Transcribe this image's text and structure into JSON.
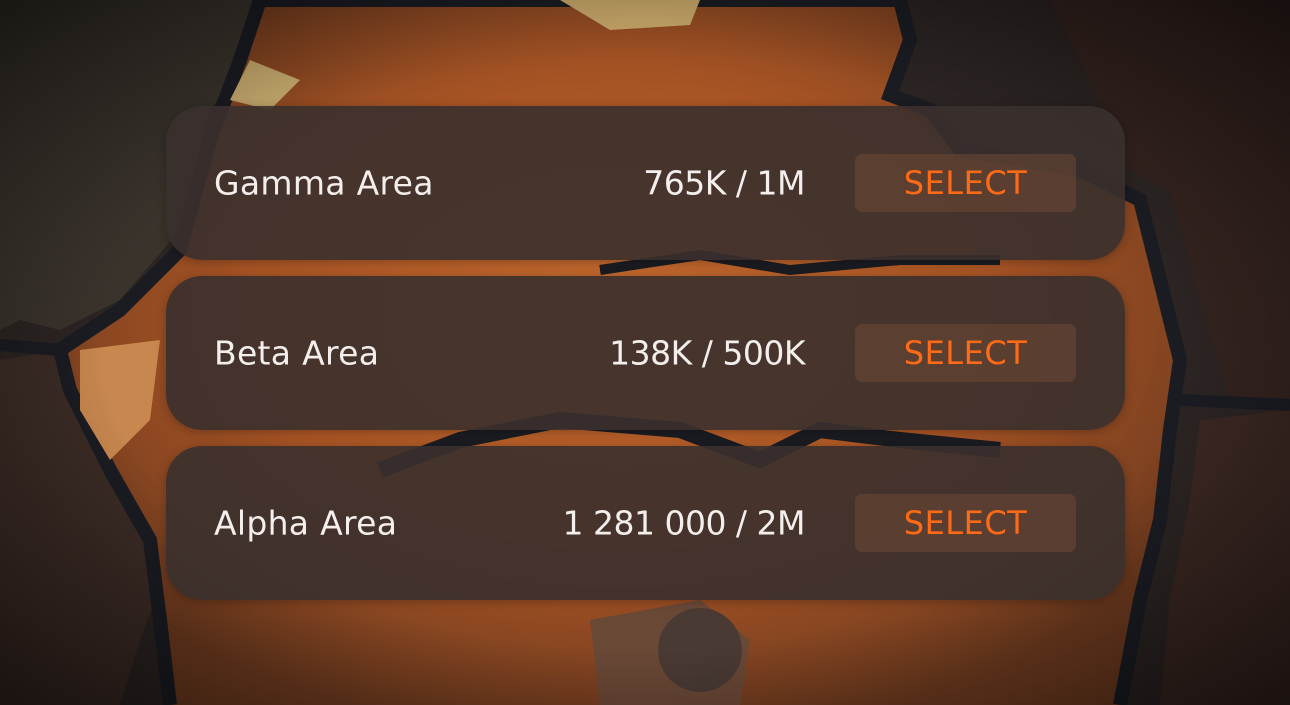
{
  "areas": [
    {
      "name": "Gamma Area",
      "value": "765K / 1M",
      "action": "SELECT"
    },
    {
      "name": "Beta Area",
      "value": "138K / 500K",
      "action": "SELECT"
    },
    {
      "name": "Alpha Area",
      "value": "1 281 000 / 2M",
      "action": "SELECT"
    }
  ],
  "colors": {
    "accent": "#ff6a16",
    "text": "#f4efec",
    "panel": "#3a302e",
    "terrain": "#b45a26",
    "border": "#1a1c22"
  }
}
